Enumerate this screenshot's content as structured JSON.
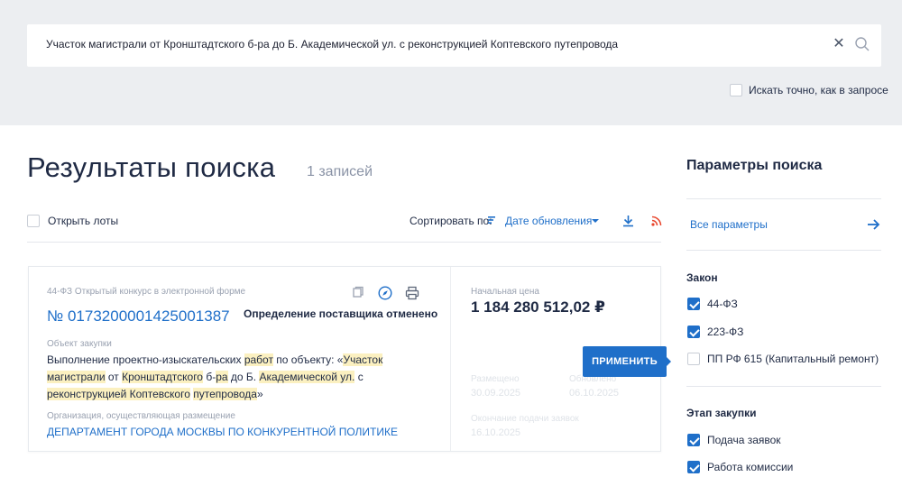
{
  "search": {
    "query": "Участок магистрали от Кронштадтского б-ра до Б. Академической ул. с реконструкцией Коптевского путепровода",
    "exact_label": "Искать точно, как в запросе"
  },
  "results": {
    "title": "Результаты поиска",
    "count": "1 записей",
    "open_lots_label": "Открыть лоты",
    "sort_label": "Сортировать по:",
    "sort_value": "Дате обновления"
  },
  "card": {
    "type": "44-ФЗ Открытый конкурс в электронной форме",
    "number": "№ 0173200001425001387",
    "status": "Определение поставщика отменено",
    "object_label": "Объект закупки",
    "object_text": {
      "p1": "Выполнение проектно-изыскательских ",
      "h1": "работ",
      "p2": " по объекту: «",
      "h2": "Участок магистрали",
      "p3": " от ",
      "h3": "Кронштадтского",
      "p4": " б-",
      "h4": "ра",
      "p5": " до Б. ",
      "h5": "Академической ул.",
      "p6": " с ",
      "h6": "реконструкцией Коптевского",
      "p7": " ",
      "h7": "путепровода",
      "p8": "»"
    },
    "org_label": "Организация, осуществляющая размещение",
    "org_name": "ДЕПАРТАМЕНТ ГОРОДА МОСКВЫ ПО КОНКУРЕНТНОЙ ПОЛИТИКЕ",
    "price_label": "Начальная цена",
    "price_value": "1 184 280 512,02 ₽",
    "placed_label": "Размещено",
    "placed_value": "30.09.2025",
    "updated_label": "Обновлено",
    "updated_value": "06.10.2025",
    "deadline_label": "Окончание подачи заявок",
    "deadline_value": "16.10.2025"
  },
  "apply_button": "ПРИМЕНИТЬ",
  "sidebar": {
    "title": "Параметры поиска",
    "all_params": "Все параметры",
    "law_title": "Закон",
    "laws": [
      {
        "label": "44-ФЗ",
        "checked": true
      },
      {
        "label": "223-ФЗ",
        "checked": true
      },
      {
        "label": "ПП РФ 615 (Капитальный ремонт)",
        "checked": false
      }
    ],
    "stage_title": "Этап закупки",
    "stages": [
      {
        "label": "Подача заявок",
        "checked": true
      },
      {
        "label": "Работа комиссии",
        "checked": true
      }
    ]
  },
  "colors": {
    "accent": "#1f6fc9",
    "highlight": "#fbf0c0",
    "rss": "#e8452c",
    "band": "#eceef1"
  }
}
